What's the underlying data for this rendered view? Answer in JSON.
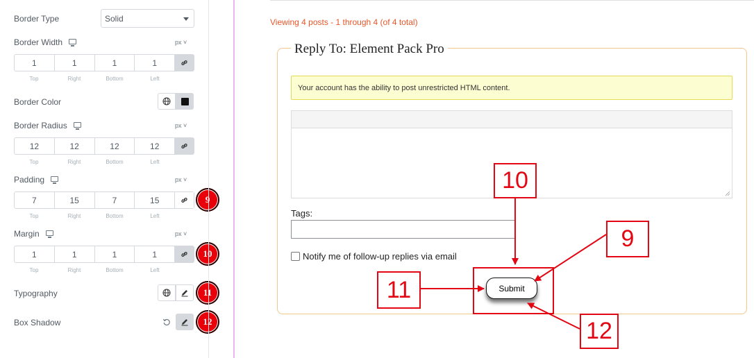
{
  "panel": {
    "border_type": {
      "label": "Border Type",
      "value": "Solid"
    },
    "border_width": {
      "label": "Border Width",
      "unit": "px",
      "values": [
        "1",
        "1",
        "1",
        "1"
      ]
    },
    "border_color": {
      "label": "Border Color",
      "swatch": "#111111"
    },
    "border_radius": {
      "label": "Border Radius",
      "unit": "px",
      "values": [
        "12",
        "12",
        "12",
        "12"
      ]
    },
    "padding": {
      "label": "Padding",
      "unit": "px",
      "values": [
        "7",
        "15",
        "7",
        "15"
      ],
      "badge": "9"
    },
    "margin": {
      "label": "Margin",
      "unit": "px",
      "values": [
        "1",
        "1",
        "1",
        "1"
      ],
      "badge": "10"
    },
    "typography": {
      "label": "Typography",
      "badge": "11"
    },
    "box_shadow": {
      "label": "Box Shadow",
      "badge": "12"
    },
    "sides": [
      "Top",
      "Right",
      "Bottom",
      "Left"
    ]
  },
  "content": {
    "viewing": "Viewing 4 posts - 1 through 4 (of 4 total)",
    "legend": "Reply To: Element Pack Pro",
    "notice": "Your account has the ability to post unrestricted HTML content.",
    "tags_label": "Tags:",
    "tags_value": "",
    "notify_label": "Notify me of follow-up replies via email",
    "submit_label": "Submit"
  },
  "annotations": {
    "callout_10": "10",
    "callout_9": "9",
    "callout_11": "11",
    "callout_12": "12",
    "color": "#e30613"
  },
  "colors": {
    "badge": "#e8000b",
    "accent_link": "#e8562a",
    "fieldset_border": "#f1c88b",
    "notice_bg": "#fdfdd2"
  }
}
